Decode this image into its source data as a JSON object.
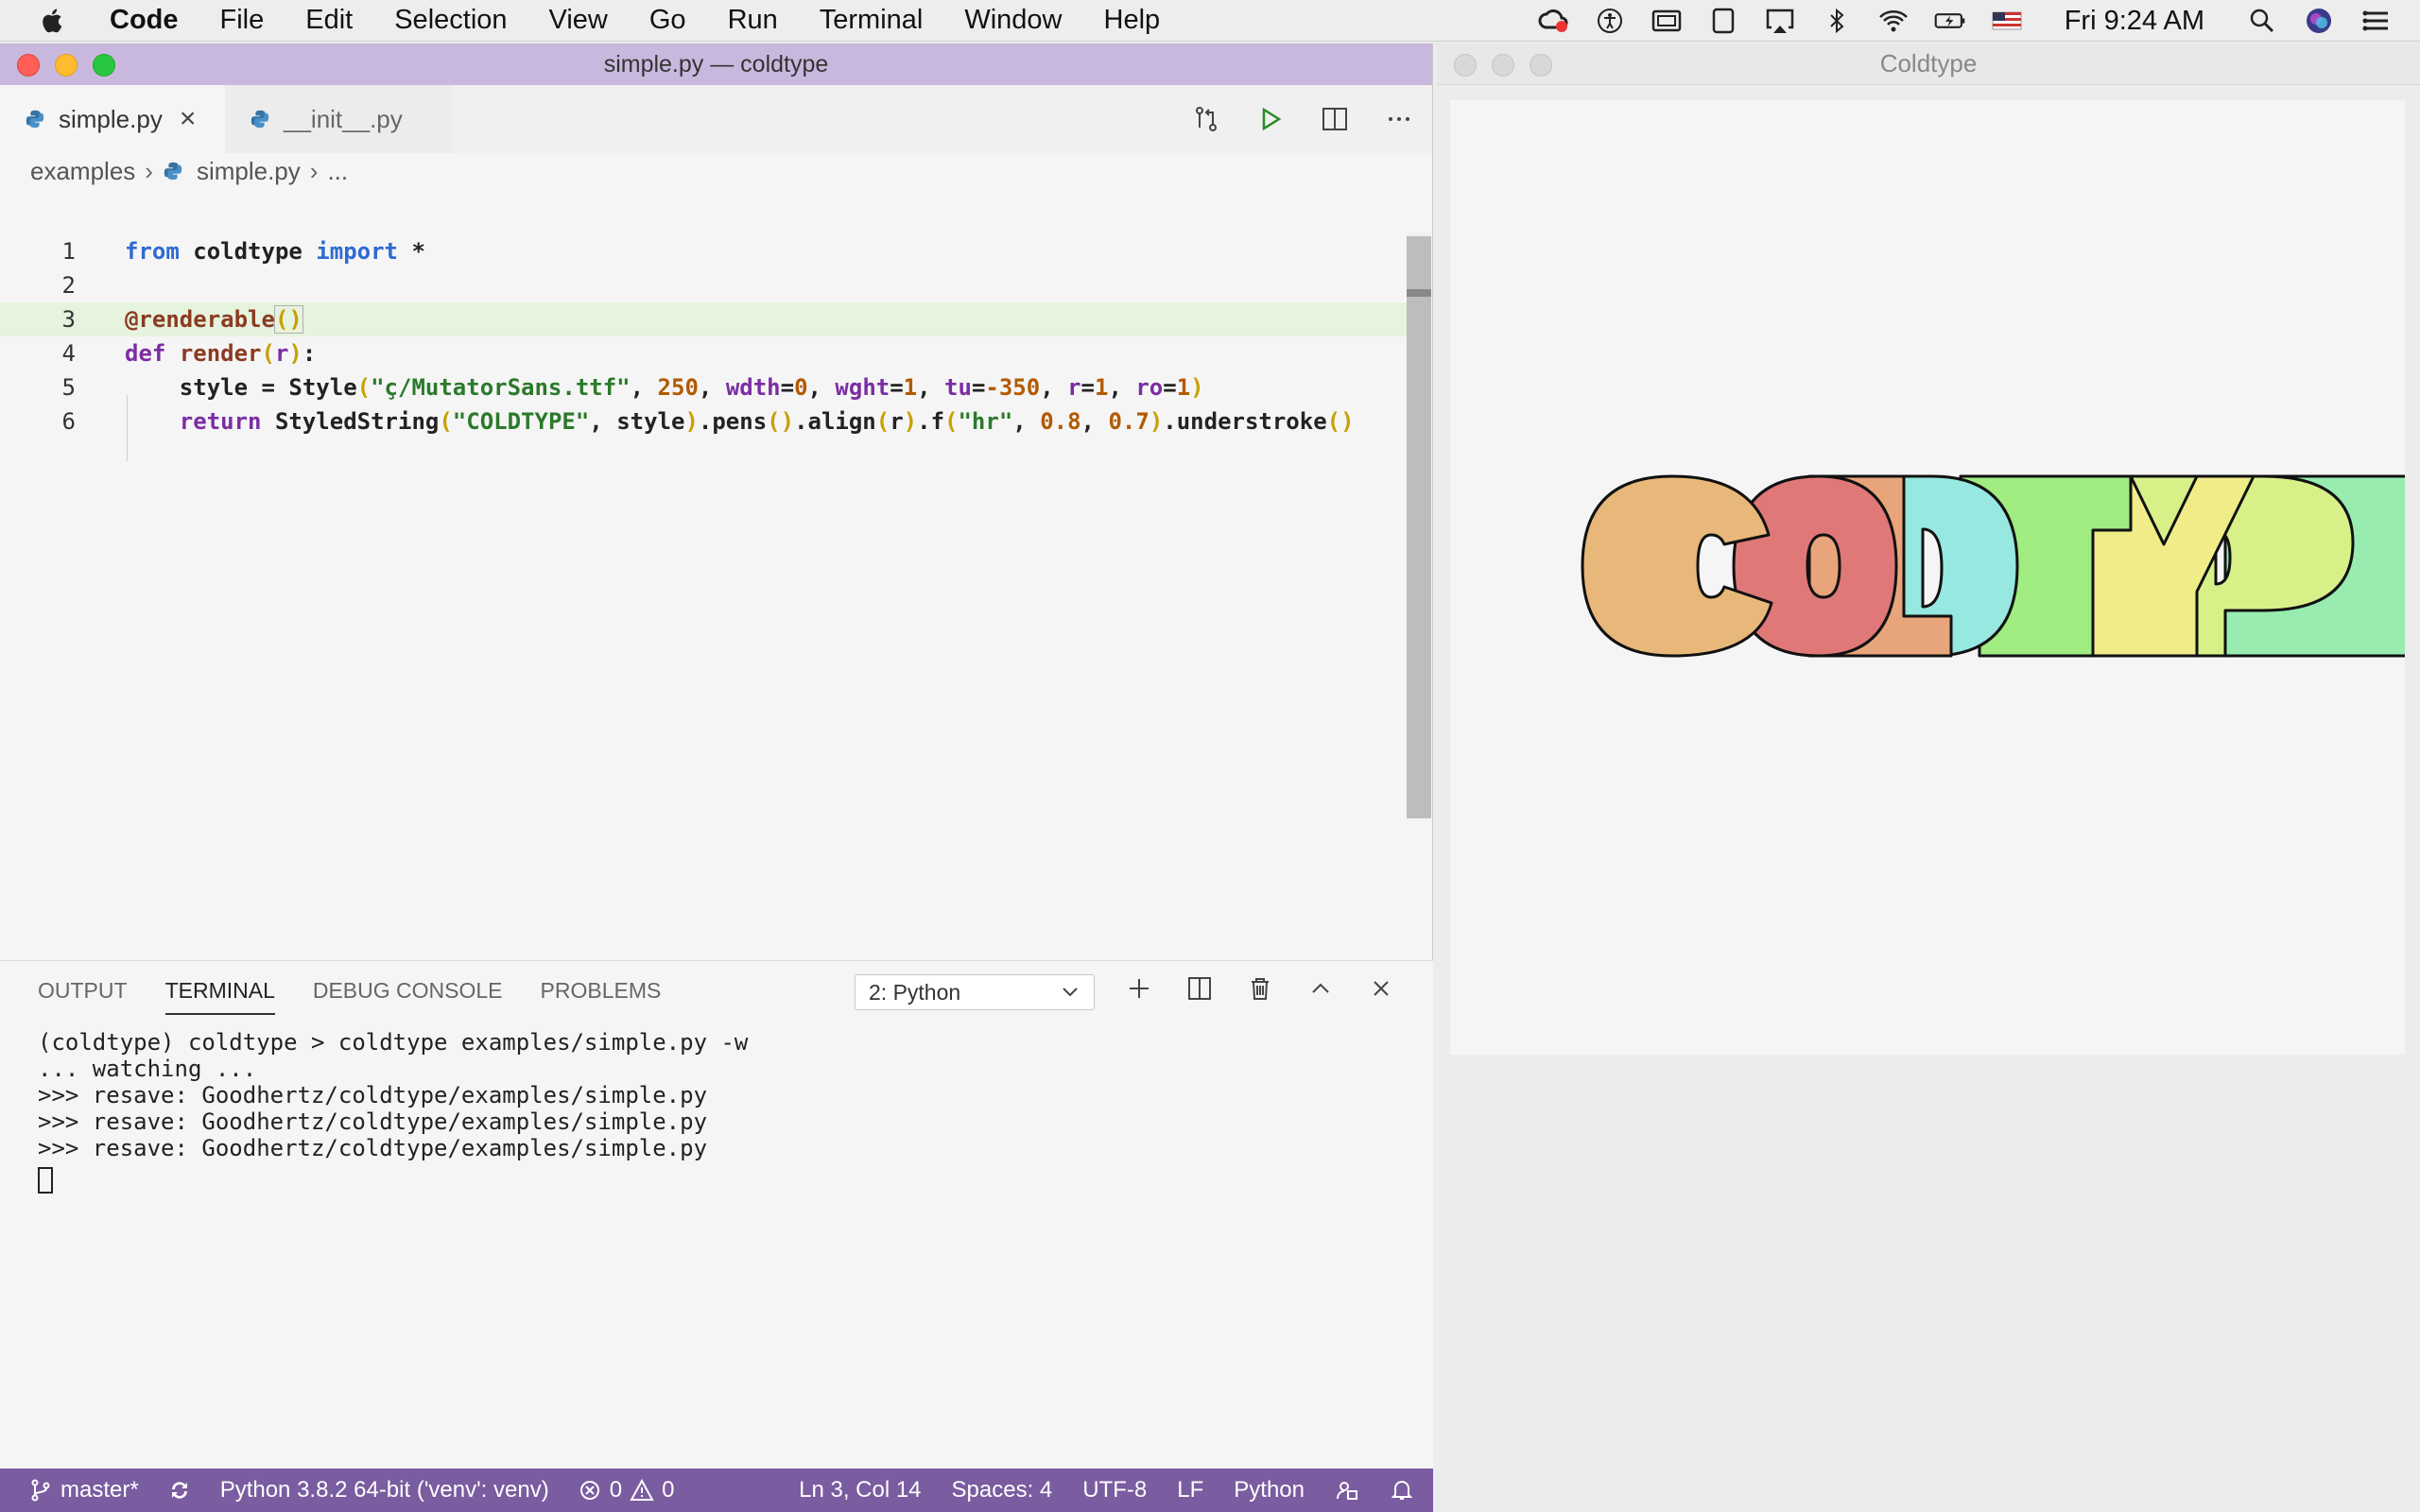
{
  "menubar": {
    "app_name": "Code",
    "menus": [
      "File",
      "Edit",
      "Selection",
      "View",
      "Go",
      "Run",
      "Terminal",
      "Window",
      "Help"
    ],
    "clock": "Fri 9:24 AM",
    "status_icons": [
      "creative-cloud-icon",
      "accessibility-icon",
      "display-icon",
      "ipad-icon",
      "airplay-icon",
      "bluetooth-icon",
      "wifi-icon",
      "battery-icon",
      "us-flag-icon",
      "spotlight-icon",
      "siri-icon",
      "control-center-icon"
    ]
  },
  "vscode": {
    "window_title": "simple.py — coldtype",
    "tabs": [
      {
        "label": "simple.py",
        "active": true
      },
      {
        "label": "__init__.py",
        "active": false
      }
    ],
    "breadcrumb": [
      "examples",
      "simple.py",
      "..."
    ],
    "code_lines": [
      {
        "number": "1",
        "text": "from coldtype import *"
      },
      {
        "number": "2",
        "text": ""
      },
      {
        "number": "3",
        "text": "@renderable()"
      },
      {
        "number": "4",
        "text": "def render(r):"
      },
      {
        "number": "5",
        "text": "    style = Style(\"ç/MutatorSans.ttf\", 250, wdth=0, wght=1, tu=-350, r=1, ro=1)"
      },
      {
        "number": "6",
        "text": "    return StyledString(\"COLDTYPE\", style).pens().align(r).f(\"hr\", 0.8, 0.7).understroke()"
      }
    ],
    "panel": {
      "tabs": [
        "OUTPUT",
        "TERMINAL",
        "DEBUG CONSOLE",
        "PROBLEMS"
      ],
      "active_tab": "TERMINAL",
      "terminal_select": "2: Python",
      "terminal_lines": [
        "(coldtype) coldtype > coldtype examples/simple.py -w",
        "... watching ...",
        ">>> resave: Goodhertz/coldtype/examples/simple.py",
        ">>> resave: Goodhertz/coldtype/examples/simple.py",
        ">>> resave: Goodhertz/coldtype/examples/simple.py"
      ]
    },
    "statusbar": {
      "branch": "master*",
      "interpreter": "Python 3.8.2 64-bit ('venv': venv)",
      "errors": "0",
      "warnings": "0",
      "position": "Ln 3, Col 14",
      "spaces": "Spaces: 4",
      "encoding": "UTF-8",
      "eol": "LF",
      "language": "Python"
    }
  },
  "coldtype_window": {
    "title": "Coldtype",
    "rendered_text": "COLDTYPE",
    "letter_colors": [
      "#e8b87a",
      "#e07878",
      "#e8a47a",
      "#96e8e0",
      "#a0ec80",
      "#f0ec88",
      "#d8f088",
      "#98ecb0"
    ]
  }
}
